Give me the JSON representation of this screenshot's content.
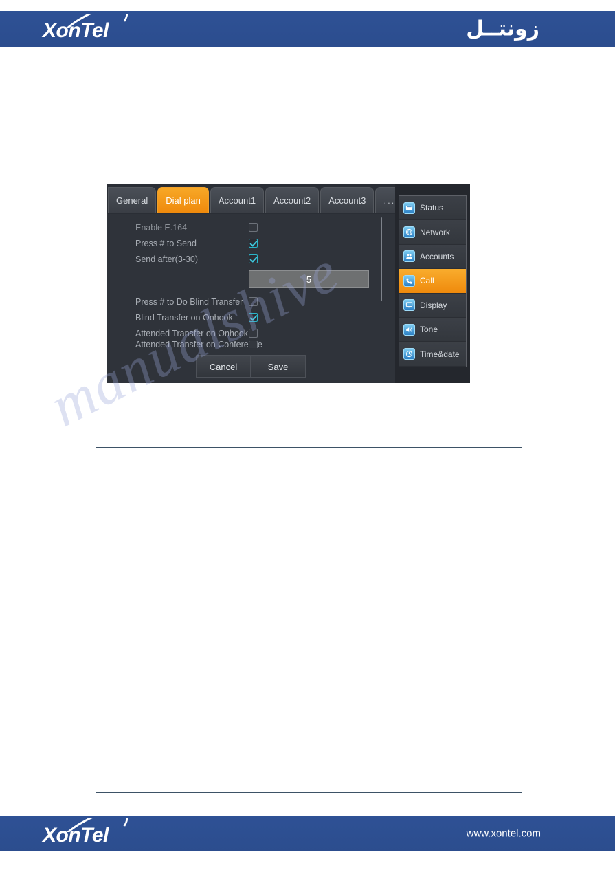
{
  "header": {
    "logo_text": "XonTel",
    "arabic_logo": "زونتــل"
  },
  "footer": {
    "logo_text": "XonTel",
    "url": "www.xontel.com"
  },
  "watermark": {
    "text": "manualshive"
  },
  "device": {
    "tabs": [
      {
        "label": "General",
        "active": false
      },
      {
        "label": "Dial plan",
        "active": true
      },
      {
        "label": "Account1",
        "active": false
      },
      {
        "label": "Account2",
        "active": false
      },
      {
        "label": "Account3",
        "active": false
      },
      {
        "label": "...",
        "active": false
      }
    ],
    "settings": [
      {
        "label": "Enable E.164",
        "checked": false
      },
      {
        "label": "Press # to Send",
        "checked": true
      },
      {
        "label": "Send after(3-30)",
        "checked": true
      }
    ],
    "value_field": {
      "value": "5",
      "placeholder": ""
    },
    "settings_lower": [
      {
        "label": "Press # to Do Blind Transfer",
        "checked": false
      },
      {
        "label": "Blind Transfer on Onhook",
        "checked": true
      },
      {
        "label": "Attended Transfer on Onhook",
        "checked": false
      }
    ],
    "settings_clipped": [
      {
        "label": "Attended Transfer on Conference",
        "checked": false
      }
    ],
    "buttons": {
      "cancel": "Cancel",
      "save": "Save"
    },
    "sidebar": [
      {
        "label": "Status",
        "icon": "status-monitor-icon",
        "active": false
      },
      {
        "label": "Network",
        "icon": "globe-icon",
        "active": false
      },
      {
        "label": "Accounts",
        "icon": "accounts-people-icon",
        "active": false
      },
      {
        "label": "Call",
        "icon": "phone-handset-icon",
        "active": true
      },
      {
        "label": "Display",
        "icon": "display-monitor-icon",
        "active": false
      },
      {
        "label": "Tone",
        "icon": "speaker-icon",
        "active": false
      },
      {
        "label": "Time&date",
        "icon": "clock-icon",
        "active": false
      }
    ]
  },
  "colors": {
    "brand_blue": "#2c4f92",
    "accent_orange": "#ef8a0c",
    "checkbox_teal": "#3fc8dd",
    "panel_dark": "#2f333a",
    "rule_slate": "#3d5266"
  }
}
